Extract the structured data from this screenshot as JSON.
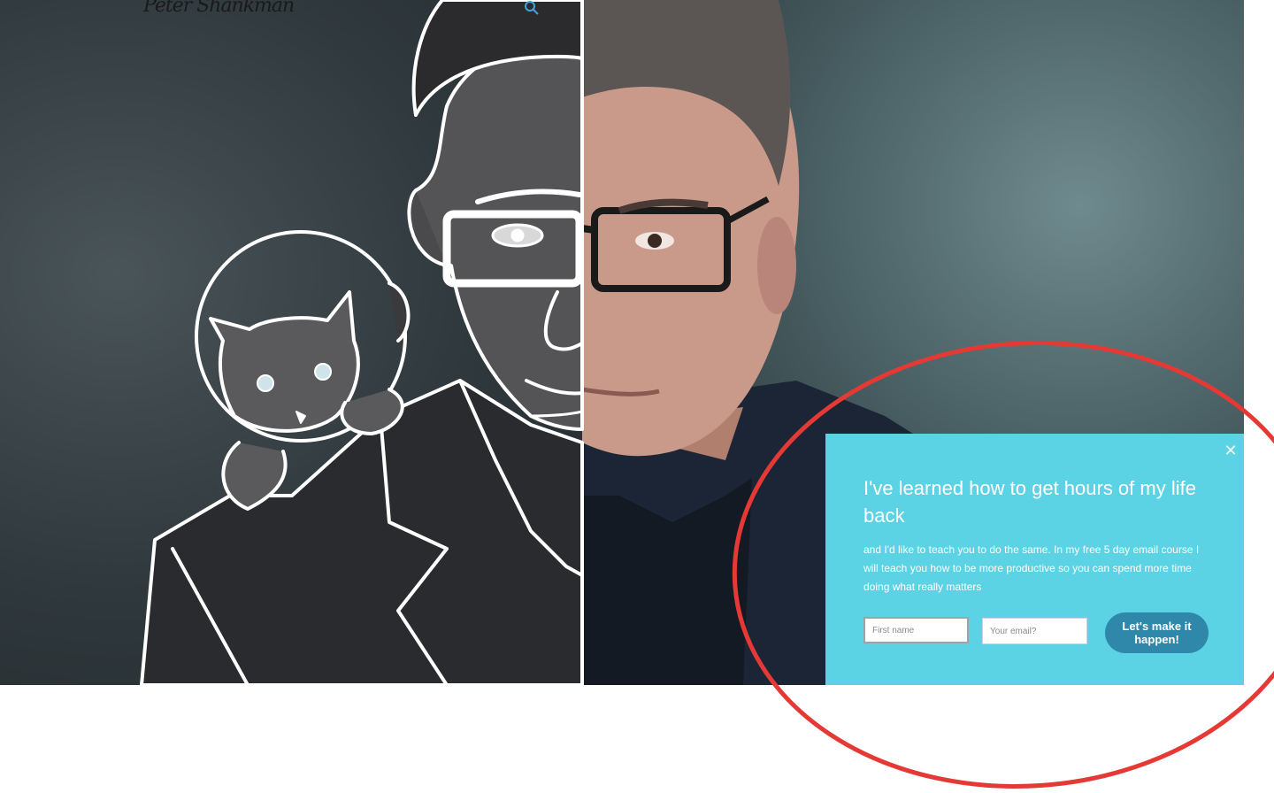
{
  "header": {
    "logo_text": "Peter Shankman",
    "search_icon": "search-icon"
  },
  "hero": {
    "left_panel": "illustrated-portrait-with-astronaut-cat",
    "right_panel": "portrait-photo"
  },
  "popup": {
    "title": "I've learned how to get hours of my life back",
    "body": "and I'd like to teach you to do the same. In my free 5 day email course I will teach you how to be more productive so you can spend more time doing what really matters",
    "first_name_placeholder": "First name",
    "email_placeholder": "Your email?",
    "cta_label": "Let's make it happen!",
    "close_icon": "close-icon",
    "background_color": "#5bd3e4",
    "button_color": "#2f87a9"
  },
  "annotation": {
    "shape": "red-ellipse",
    "color": "#e53935"
  }
}
